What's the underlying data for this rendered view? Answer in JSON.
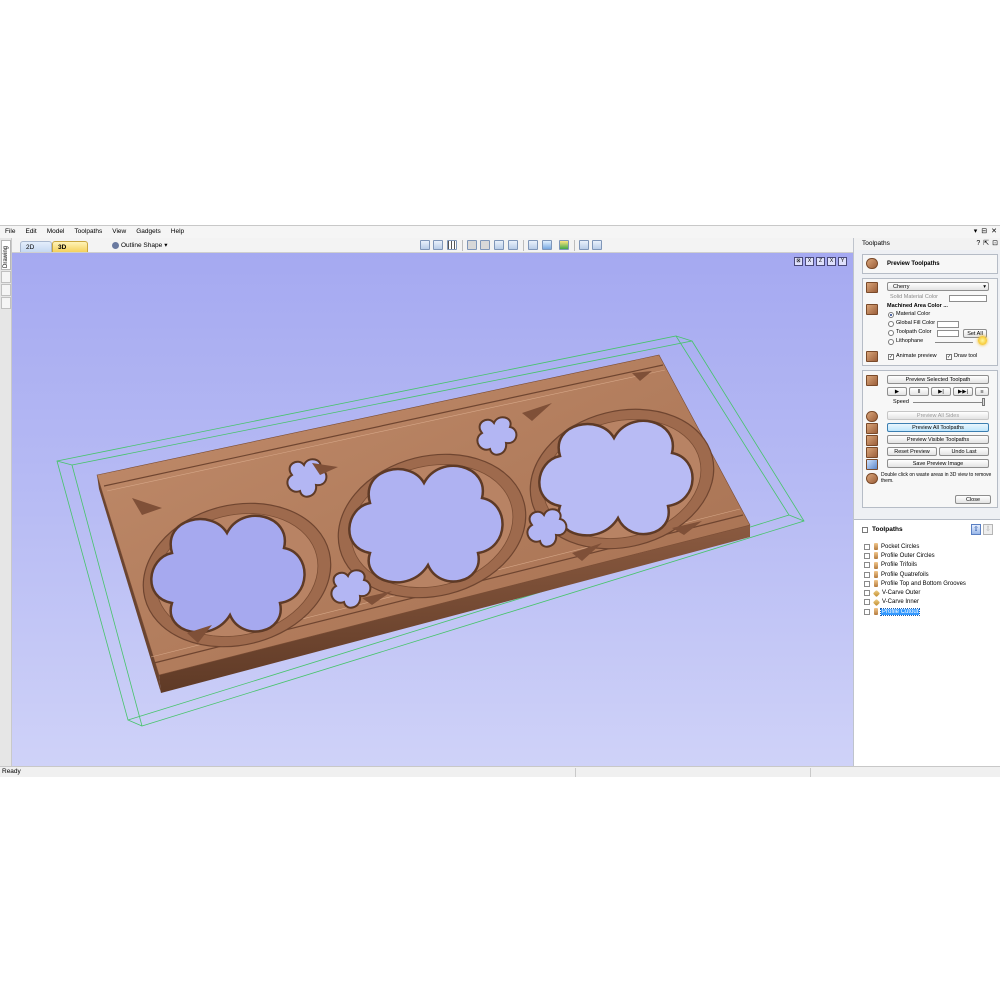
{
  "menu": [
    "File",
    "Edit",
    "Model",
    "Toolpaths",
    "View",
    "Gadgets",
    "Help"
  ],
  "window_controls": [
    "▾",
    "⊟",
    "✕"
  ],
  "left_tab": "Drawing",
  "view_tabs": {
    "tab_2d": "2D View",
    "tab_3d": "3D View"
  },
  "outline_shape": "Outline Shape",
  "panel": {
    "header": "Toolpaths",
    "header_icons": [
      "?",
      "⇱",
      "⊡"
    ],
    "title": "Preview Toolpaths",
    "material": "Cherry",
    "solid_material_color": "Solid Material Color",
    "machined_area_color": "Machined Area Color ...",
    "radio_material_color": "Material Color",
    "radio_global_fill": "Global Fill Color",
    "radio_toolpath_color": "Toolpath Color",
    "radio_lithophane": "Lithophane",
    "set_all": "Set All",
    "animate_preview": "Animate preview",
    "draw_tool": "Draw tool",
    "preview_selected": "Preview Selected Toolpath",
    "speed": "Speed",
    "preview_all_sides": "Preview All Sides",
    "preview_all": "Preview All Toolpaths",
    "preview_visible": "Preview Visible Toolpaths",
    "reset_preview": "Reset Preview",
    "undo_last": "Undo Last",
    "save_preview_image": "Save Preview Image",
    "hint": "Double click on waste areas in 3D view to remove them.",
    "close": "Close"
  },
  "toolpaths": {
    "title": "Toolpaths",
    "items": [
      {
        "name": "Pocket Circles",
        "kind": "profile"
      },
      {
        "name": "Profile Outer Circles",
        "kind": "profile"
      },
      {
        "name": "Profile Trifoils",
        "kind": "profile"
      },
      {
        "name": "Profile Quatrefoils",
        "kind": "profile"
      },
      {
        "name": "Profile Top and Bottom Grooves",
        "kind": "profile"
      },
      {
        "name": "V-Carve Outer",
        "kind": "vcarve"
      },
      {
        "name": "V-Carve Inner",
        "kind": "vcarve"
      },
      {
        "name": "Profile Cutout",
        "kind": "profile",
        "selected": true
      }
    ]
  },
  "status": "Ready",
  "colors": {
    "wood": "#b07a5a",
    "wood_dark": "#8a5a3e",
    "viewport_top": "#a5a9f1",
    "bounding_box": "#46c46a"
  }
}
